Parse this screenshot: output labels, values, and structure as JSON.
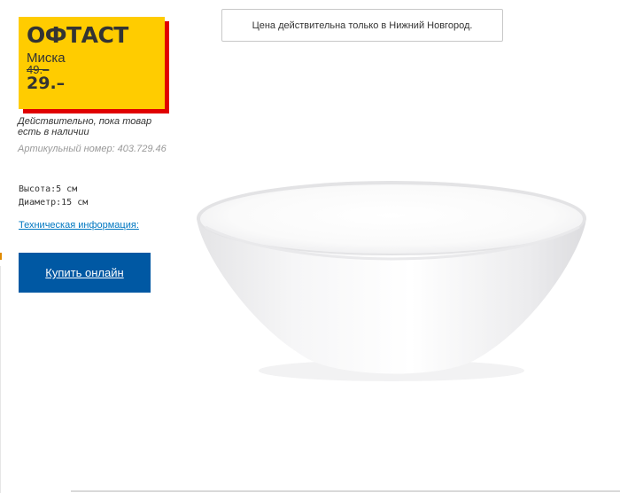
{
  "product": {
    "name": "ОФТАСТ",
    "type": "Миска",
    "old_price": "49.–",
    "new_price": "29.–",
    "valid_note": "Действительно, пока товар есть в наличии",
    "article_label": "Артикульный номер: 403.729.46",
    "height": "Высота:5 см",
    "diameter": "Диаметр:15 см",
    "tech_info_link": "Техническая информация:",
    "buy_button_label": "Купить онлайн"
  },
  "notice": {
    "city_price_note": "Цена действительна только в Нижний Новгород."
  },
  "colors": {
    "price_box_bg": "#ffcc00",
    "price_box_shadow": "#e00000",
    "buy_button_bg": "#0058a3",
    "link": "#0077c1"
  },
  "icons": {
    "product_image": "white-bowl-image"
  }
}
